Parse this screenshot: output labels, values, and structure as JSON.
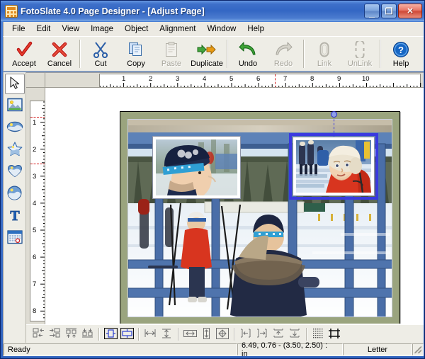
{
  "window": {
    "title": "FotoSlate 4.0 Page Designer  - [Adjust Page]",
    "app_icon": "fotoslate-icon",
    "controls": {
      "minimize": "minimize-button",
      "restore": "restore-button",
      "close": "close-button",
      "minimize_glyph": "_",
      "restore_glyph": "❐",
      "close_glyph": "✕"
    }
  },
  "menubar": {
    "items": [
      {
        "label": "File"
      },
      {
        "label": "Edit"
      },
      {
        "label": "View"
      },
      {
        "label": "Image"
      },
      {
        "label": "Object"
      },
      {
        "label": "Alignment"
      },
      {
        "label": "Window"
      },
      {
        "label": "Help"
      }
    ]
  },
  "toolbar": {
    "buttons": [
      {
        "label": "Accept",
        "icon": "checkmark-icon",
        "enabled": true
      },
      {
        "label": "Cancel",
        "icon": "cross-icon",
        "enabled": true
      },
      {
        "label": "Cut",
        "icon": "scissors-icon",
        "enabled": true
      },
      {
        "label": "Copy",
        "icon": "copy-pages-icon",
        "enabled": true
      },
      {
        "label": "Paste",
        "icon": "clipboard-icon",
        "enabled": false
      },
      {
        "label": "Duplicate",
        "icon": "two-arrows-icon",
        "enabled": true
      },
      {
        "label": "Undo",
        "icon": "undo-arrow-icon",
        "enabled": true
      },
      {
        "label": "Redo",
        "icon": "redo-arrow-icon",
        "enabled": false
      },
      {
        "label": "Link",
        "icon": "link-chain-icon",
        "enabled": false
      },
      {
        "label": "UnLink",
        "icon": "unlink-chain-icon",
        "enabled": false
      },
      {
        "label": "Help",
        "icon": "question-mark-icon",
        "enabled": true
      }
    ]
  },
  "tool_palette": {
    "tools": [
      {
        "name": "select-arrow-tool",
        "icon": "arrow-cursor-icon",
        "active": true
      },
      {
        "name": "image-cell-tool",
        "icon": "picture-icon",
        "active": false
      },
      {
        "name": "ellipse-cell-tool",
        "icon": "ellipse-photo-icon",
        "active": false
      },
      {
        "name": "star-cell-tool",
        "icon": "star-photo-icon",
        "active": false
      },
      {
        "name": "heart-cell-tool",
        "icon": "heart-photo-icon",
        "active": false
      },
      {
        "name": "circle-cell-tool",
        "icon": "circle-photo-icon",
        "active": false
      },
      {
        "name": "text-tool",
        "icon": "text-t-icon",
        "active": false
      },
      {
        "name": "calendar-tool",
        "icon": "calendar-icon",
        "active": false
      }
    ]
  },
  "rulers": {
    "units": "in",
    "horizontal": {
      "labels": [
        "1",
        "2",
        "3",
        "4",
        "5",
        "6",
        "7",
        "8",
        "9",
        "10"
      ],
      "guide_at": 6.49
    },
    "vertical": {
      "labels": [
        "1",
        "2",
        "3",
        "4",
        "5",
        "6",
        "7",
        "8"
      ],
      "guides_at": [
        0.76,
        2.5
      ]
    }
  },
  "canvas": {
    "page_border_color": "#9aa47e",
    "page_inner_color": "#7d8cb0",
    "background_photo": "winter-ski-bleachers-photo",
    "cells": [
      {
        "name": "photo-cell-left",
        "image": "boy-in-blue-knit-hat-photo",
        "selected": false
      },
      {
        "name": "photo-cell-right",
        "image": "child-in-red-jacket-white-hat-photo",
        "selected": true,
        "handles": [
          "rotation-handle"
        ]
      }
    ]
  },
  "align_toolbar": {
    "buttons": [
      {
        "name": "align-left-button",
        "icon": "align-left-icon"
      },
      {
        "name": "align-right-button",
        "icon": "align-right-icon"
      },
      {
        "name": "align-top-button",
        "icon": "align-top-icon"
      },
      {
        "name": "align-bottom-button",
        "icon": "align-bottom-icon"
      },
      {
        "name": "center-horizontally-button",
        "icon": "center-h-icon"
      },
      {
        "name": "center-vertically-button",
        "icon": "center-v-icon"
      },
      {
        "name": "space-across-button",
        "icon": "space-across-icon"
      },
      {
        "name": "space-down-button",
        "icon": "space-down-icon"
      },
      {
        "name": "same-width-button",
        "icon": "same-width-icon"
      },
      {
        "name": "same-height-button",
        "icon": "same-height-icon"
      },
      {
        "name": "same-size-button",
        "icon": "same-size-icon"
      },
      {
        "name": "distribute-left-button",
        "icon": "distribute-left-icon"
      },
      {
        "name": "distribute-right-button",
        "icon": "distribute-right-icon"
      },
      {
        "name": "distribute-top-button",
        "icon": "distribute-top-icon"
      },
      {
        "name": "distribute-bottom-button",
        "icon": "distribute-bottom-icon"
      },
      {
        "name": "snap-to-grid-button",
        "icon": "grid-dots-icon"
      },
      {
        "name": "page-bounds-button",
        "icon": "page-bounds-icon"
      }
    ]
  },
  "statusbar": {
    "message": "Ready",
    "coordinates": "6.49, 0.76 - (3.50, 2.50) : in",
    "paper_size": "Letter",
    "grip": "resize-grip"
  }
}
